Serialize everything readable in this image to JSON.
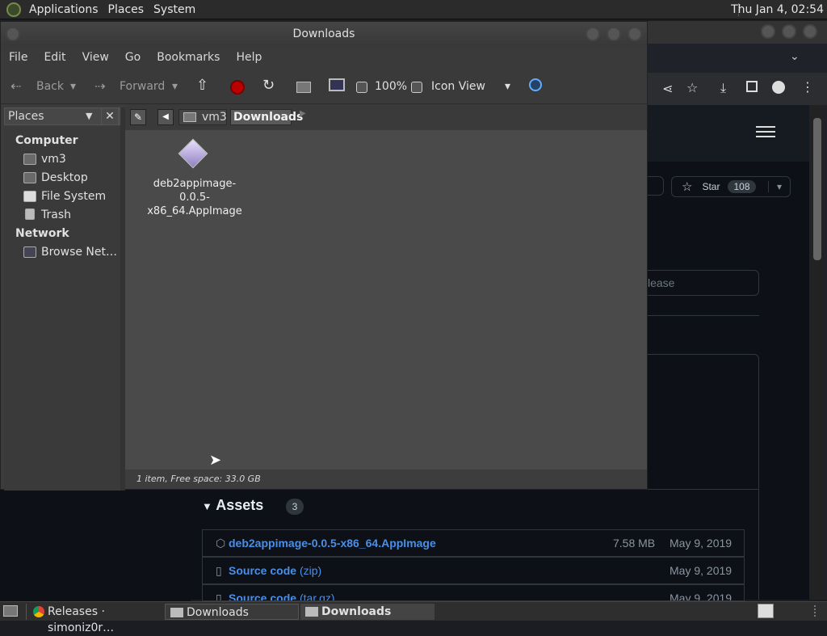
{
  "top_panel": {
    "applications": "Applications",
    "places": "Places",
    "system": "System",
    "clock": "Thu Jan  4, 02:54"
  },
  "file_manager": {
    "title": "Downloads",
    "menu": [
      "File",
      "Edit",
      "View",
      "Go",
      "Bookmarks",
      "Help"
    ],
    "toolbar": {
      "back": "Back",
      "forward": "Forward",
      "zoom": "100%",
      "view_mode": "Icon View"
    },
    "places_label": "Places",
    "sidebar": {
      "computer": "Computer",
      "items_computer": [
        "vm3",
        "Desktop",
        "File System",
        "Trash"
      ],
      "network": "Network",
      "items_network": [
        "Browse Net…"
      ]
    },
    "path": [
      "vm3",
      "Downloads"
    ],
    "file": {
      "name_line1": "deb2appimage-0.0.5-",
      "name_line2": "x86_64.AppImage"
    },
    "status": "1 item, Free space: 33.0 GB"
  },
  "browser": {
    "star_label": "Star",
    "star_count": "108",
    "search_placeholder": "lease",
    "assets_title": "Assets",
    "assets_count": "3",
    "assets": [
      {
        "name": "deb2appimage-0.0.5-x86_64.AppImage",
        "suffix": "",
        "size": "7.58 MB",
        "date": "May 9, 2019"
      },
      {
        "name": "Source code",
        "suffix": "(zip)",
        "size": "",
        "date": "May 9, 2019"
      },
      {
        "name": "Source code",
        "suffix": "(tar.gz)",
        "size": "",
        "date": "May 9, 2019"
      }
    ]
  },
  "taskbar": {
    "tasks": [
      "Releases · simoniz0r…",
      "Downloads",
      "Downloads"
    ]
  },
  "colors": {
    "link": "#4a8fe7",
    "accent": "#c00"
  }
}
